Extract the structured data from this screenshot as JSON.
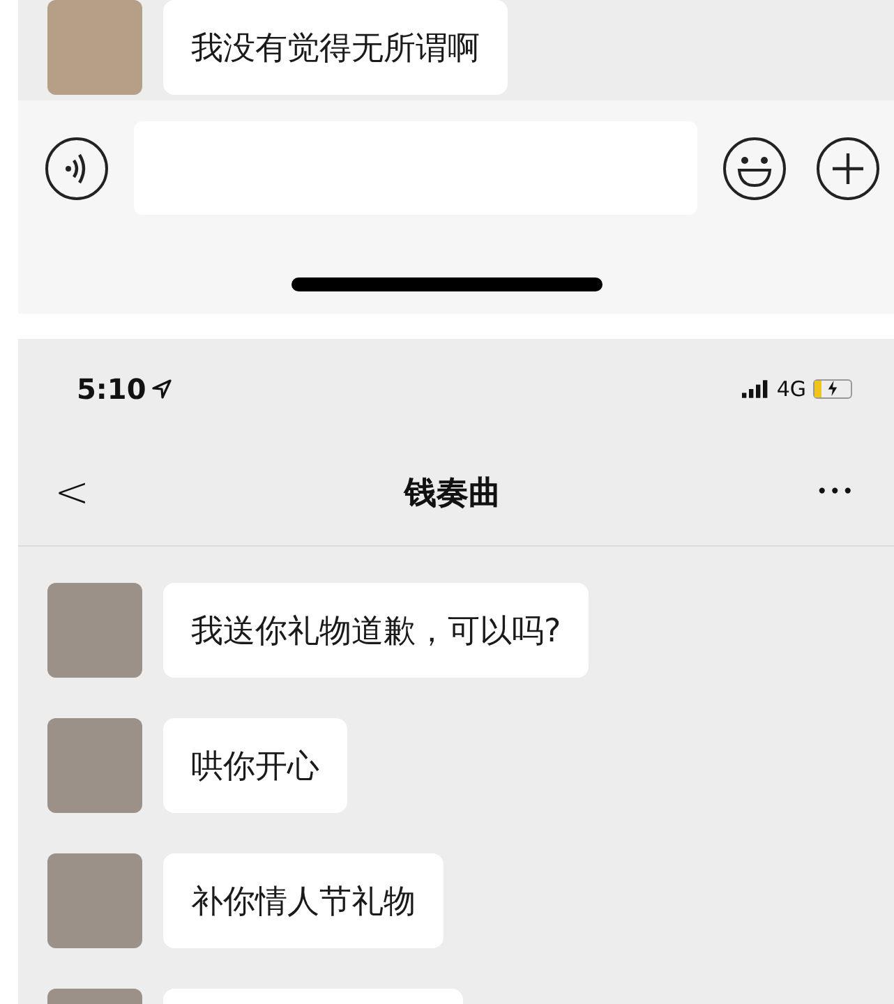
{
  "top_panel": {
    "messages": [
      {
        "kind": "text",
        "text": "我没有觉得无所谓啊"
      }
    ]
  },
  "bottom_panel": {
    "status_bar": {
      "time": "5:10",
      "network": "4G"
    },
    "nav": {
      "back": "<",
      "title": "钱奏曲",
      "more": "•••"
    },
    "messages": [
      {
        "kind": "text",
        "text": "我送你礼物道歉，可以吗?"
      },
      {
        "kind": "text",
        "text": "哄你开心"
      },
      {
        "kind": "text",
        "text": "补你情人节礼物"
      },
      {
        "kind": "cut"
      }
    ]
  }
}
